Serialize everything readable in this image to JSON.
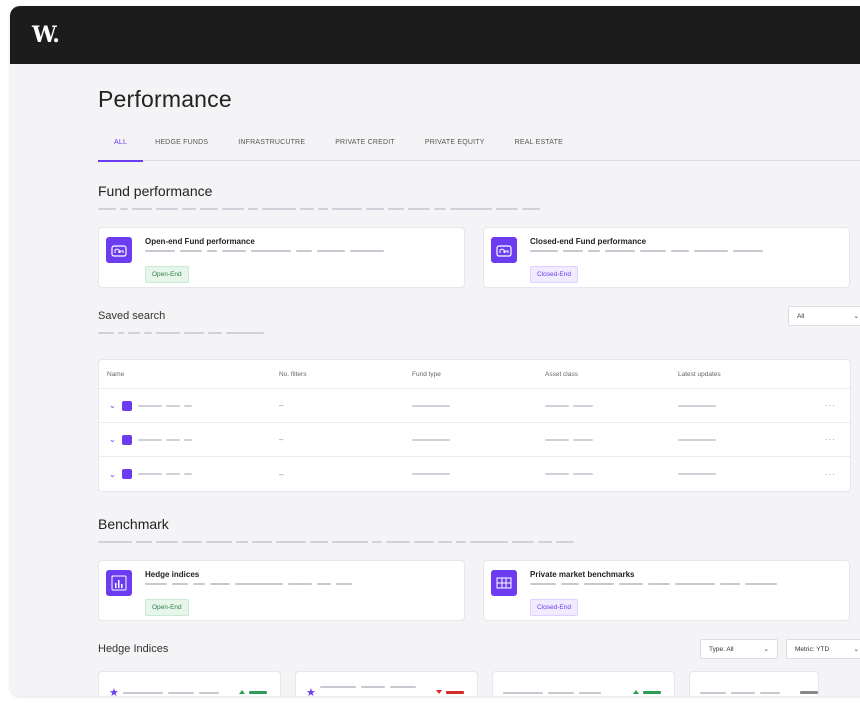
{
  "app": {
    "logo": "W."
  },
  "page": {
    "title": "Performance"
  },
  "tabs": [
    {
      "label": "ALL",
      "active": true
    },
    {
      "label": "HEDGE FUNDS"
    },
    {
      "label": "INFRASTRUCUTRE"
    },
    {
      "label": "PRIVATE CREDIT"
    },
    {
      "label": "PRIVATE EQUITY"
    },
    {
      "label": "REAL ESTATE"
    }
  ],
  "fund_performance": {
    "title": "Fund performance",
    "cards": [
      {
        "title": "Open-end Fund performance",
        "badge": "Open-End",
        "icon": "building-icon"
      },
      {
        "title": "Closed-end Fund performance",
        "badge": "Closed-End",
        "icon": "building-icon"
      }
    ]
  },
  "saved_search": {
    "title": "Saved search",
    "filter_value": "All",
    "columns": [
      "Name",
      "No. filters",
      "Fund type",
      "Asset class",
      "Latest updates"
    ],
    "rows": [
      {
        "filters": "–",
        "more": "···"
      },
      {
        "filters": "–",
        "more": "···"
      },
      {
        "filters": "–",
        "more": "···"
      }
    ]
  },
  "benchmark": {
    "title": "Benchmark",
    "cards": [
      {
        "title": "Hedge indices",
        "badge": "Open-End",
        "icon": "bar-chart-icon"
      },
      {
        "title": "Private market benchmarks",
        "badge": "Closed-End",
        "icon": "grid-icon"
      }
    ]
  },
  "hedge_indices": {
    "title": "Hedge Indices",
    "type_select": "Type: All",
    "metric_select": "Metric: YTD"
  },
  "colors": {
    "accent": "#6b3cf0",
    "positive": "#2e9e57",
    "negative": "#d62b2b",
    "topbar": "#1c1c1c"
  }
}
